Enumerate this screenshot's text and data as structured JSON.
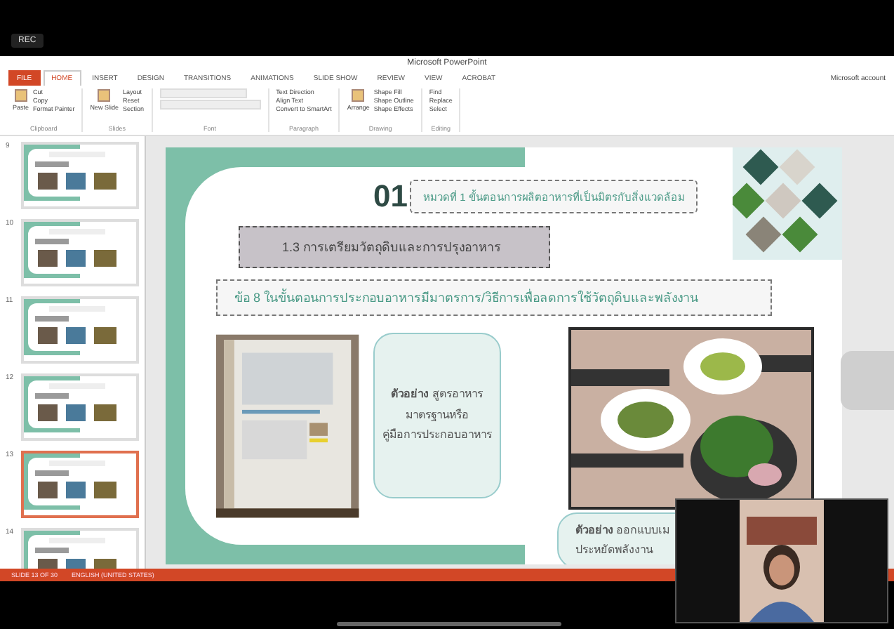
{
  "recording": {
    "label": "REC"
  },
  "window": {
    "title": "Microsoft PowerPoint",
    "account": "Microsoft account"
  },
  "tabs": [
    {
      "label": "FILE",
      "kind": "file",
      "selected": false
    },
    {
      "label": "HOME",
      "kind": "tab",
      "selected": true
    },
    {
      "label": "INSERT",
      "kind": "tab",
      "selected": false
    },
    {
      "label": "DESIGN",
      "kind": "tab",
      "selected": false
    },
    {
      "label": "TRANSITIONS",
      "kind": "tab",
      "selected": false
    },
    {
      "label": "ANIMATIONS",
      "kind": "tab",
      "selected": false
    },
    {
      "label": "SLIDE SHOW",
      "kind": "tab",
      "selected": false
    },
    {
      "label": "REVIEW",
      "kind": "tab",
      "selected": false
    },
    {
      "label": "VIEW",
      "kind": "tab",
      "selected": false
    },
    {
      "label": "ACROBAT",
      "kind": "tab",
      "selected": false
    }
  ],
  "ribbon": [
    {
      "label": "Clipboard",
      "big": "Paste",
      "items": [
        "Cut",
        "Copy",
        "Format Painter"
      ]
    },
    {
      "label": "Slides",
      "big": "New Slide",
      "items": [
        "Layout",
        "Reset",
        "Section"
      ]
    },
    {
      "label": "Font"
    },
    {
      "label": "Paragraph",
      "items": [
        "Text Direction",
        "Align Text",
        "Convert to SmartArt"
      ]
    },
    {
      "label": "Drawing",
      "big": "Arrange",
      "items": [
        "Shape Fill",
        "Shape Outline",
        "Shape Effects"
      ]
    },
    {
      "label": "Editing",
      "items": [
        "Find",
        "Replace",
        "Select"
      ]
    }
  ],
  "thumbnails": [
    {
      "number": "9",
      "selected": false
    },
    {
      "number": "10",
      "selected": false
    },
    {
      "number": "11",
      "selected": false
    },
    {
      "number": "12",
      "selected": false
    },
    {
      "number": "13",
      "selected": true
    },
    {
      "number": "14",
      "selected": false
    }
  ],
  "slide": {
    "badge": "01",
    "heading": "หมวดที่ 1 ขั้นตอนการผลิตอาหารที่เป็นมิตรกับสิ่งแวดล้อม",
    "section": "1.3 การเตรียมวัตถุดิบและการปรุงอาหาร",
    "point": "ข้อ 8 ในขั้นตอนการประกอบอาหารมีมาตรการ/วิธีการเพื่อลดการใช้วัตถุดิบและพลังงาน",
    "callouts": [
      {
        "lines": [
          "**ตัวอย่าง** สูตรอาหาร",
          "มาตรฐานหรือ",
          "คู่มือการประกอบอาหาร"
        ]
      },
      {
        "lines": [
          "**ตัวอย่าง** ออกแบบเม",
          "ประหยัดพลังงาน"
        ]
      }
    ]
  },
  "status_bar": {
    "slide": "SLIDE 13 OF 30",
    "language": "ENGLISH (UNITED STATES)"
  }
}
